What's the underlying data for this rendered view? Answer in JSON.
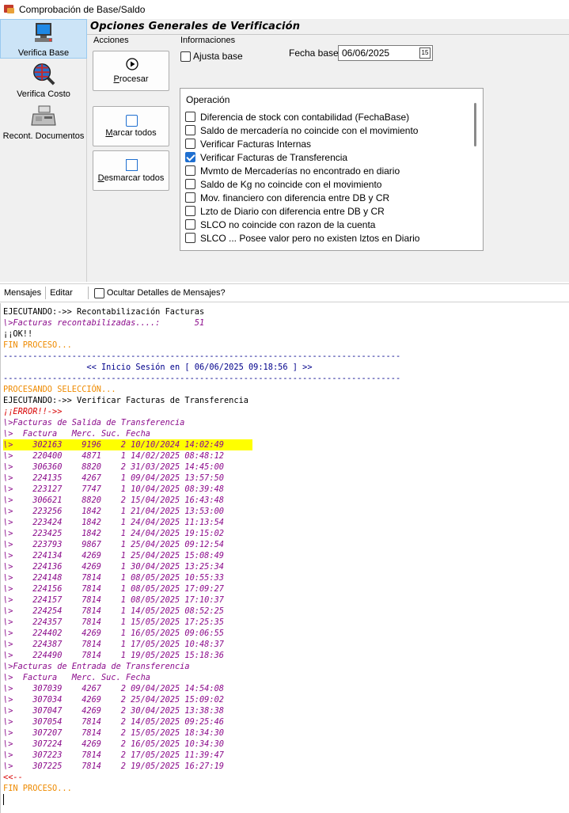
{
  "window": {
    "title": "Comprobación de Base/Saldo"
  },
  "nav": {
    "items": [
      {
        "label": "Verifica Base",
        "icon": "computer-icon",
        "active": true
      },
      {
        "label": "Verifica Costo",
        "icon": "globe-magnifier-icon",
        "active": false
      },
      {
        "label": "Recont. Documentos",
        "icon": "cash-register-icon",
        "active": false
      }
    ]
  },
  "header": {
    "title": "Opciones Generales de Verificación"
  },
  "acciones": {
    "label": "Acciones",
    "procesar_prefix": "",
    "procesar_underline": "P",
    "procesar_rest": "rocesar",
    "marcar_underline": "M",
    "marcar_rest": "arcar todos",
    "desmarcar_underline": "D",
    "desmarcar_rest": "esmarcar todos"
  },
  "informaciones": {
    "label": "Informaciones",
    "ajusta_base_label": "Ajusta base",
    "ajusta_base_checked": false,
    "fecha_base_label": "Fecha base",
    "fecha_base_value": "06/06/2025",
    "calendar_glyph": "15"
  },
  "operacion": {
    "title": "Operación",
    "items": [
      {
        "label": "Diferencia de stock con contabilidad (FechaBase)",
        "checked": false
      },
      {
        "label": "Saldo de mercadería no coincide con el movimiento",
        "checked": false
      },
      {
        "label": "Verificar Facturas Internas",
        "checked": false
      },
      {
        "label": "Verificar Facturas de Transferencia",
        "checked": true
      },
      {
        "label": "Mvmto de Mercaderías no encontrado en diario",
        "checked": false
      },
      {
        "label": "Saldo de Kg no coincide con el movimiento",
        "checked": false
      },
      {
        "label": "Mov. financiero con diferencia entre DB y CR",
        "checked": false
      },
      {
        "label": "Lzto de Diario con diferencia entre DB y CR",
        "checked": false
      },
      {
        "label": "SLCO no coincide con razon de la cuenta",
        "checked": false
      },
      {
        "label": "SLCO ... Posee valor pero no existen lztos en Diario",
        "checked": false
      }
    ]
  },
  "toolbar": {
    "mensajes": "Mensajes",
    "editar": "Editar",
    "ocultar_label": "Ocultar Detalles de Mensajes?",
    "ocultar_checked": false
  },
  "console": {
    "lines": [
      {
        "text": "EJECUTANDO:->> Recontabilización Facturas",
        "style": "black"
      },
      {
        "text": "\\>Facturas recontabilizadas....:       51",
        "style": "purple"
      },
      {
        "text": "¡¡OK!!",
        "style": "black"
      },
      {
        "text": "FIN PROCESO...",
        "style": "orange"
      },
      {
        "text": "---------------------------------------------------------------------------------",
        "style": "navy"
      },
      {
        "text": "                 << Inicio Sesión en [ 06/06/2025 09:18:56 ] >>",
        "style": "navy"
      },
      {
        "text": "---------------------------------------------------------------------------------",
        "style": "navy"
      },
      {
        "text": "PROCESANDO SELECCIÓN...",
        "style": "orange"
      },
      {
        "text": "EJECUTANDO:->> Verificar Facturas de Transferencia",
        "style": "black"
      },
      {
        "text": "¡¡ERROR!!->>",
        "style": "red"
      },
      {
        "text": "\\>Facturas de Salida de Transferencia",
        "style": "purple"
      },
      {
        "text": "\\>  Factura   Merc. Suc. Fecha",
        "style": "purple"
      },
      {
        "text": "\\>    302163    9196    2 10/10/2024 14:02:49",
        "style": "purple",
        "highlight": true
      },
      {
        "text": "\\>    220400    4871    1 14/02/2025 08:48:12",
        "style": "purple"
      },
      {
        "text": "\\>    306360    8820    2 31/03/2025 14:45:00",
        "style": "purple"
      },
      {
        "text": "\\>    224135    4267    1 09/04/2025 13:57:50",
        "style": "purple"
      },
      {
        "text": "\\>    223127    7747    1 10/04/2025 08:39:48",
        "style": "purple"
      },
      {
        "text": "\\>    306621    8820    2 15/04/2025 16:43:48",
        "style": "purple"
      },
      {
        "text": "\\>    223256    1842    1 21/04/2025 13:53:00",
        "style": "purple"
      },
      {
        "text": "\\>    223424    1842    1 24/04/2025 11:13:54",
        "style": "purple"
      },
      {
        "text": "\\>    223425    1842    1 24/04/2025 19:15:02",
        "style": "purple"
      },
      {
        "text": "\\>    223793    9867    1 25/04/2025 09:12:54",
        "style": "purple"
      },
      {
        "text": "\\>    224134    4269    1 25/04/2025 15:08:49",
        "style": "purple"
      },
      {
        "text": "\\>    224136    4269    1 30/04/2025 13:25:34",
        "style": "purple"
      },
      {
        "text": "\\>    224148    7814    1 08/05/2025 10:55:33",
        "style": "purple"
      },
      {
        "text": "\\>    224156    7814    1 08/05/2025 17:09:27",
        "style": "purple"
      },
      {
        "text": "\\>    224157    7814    1 08/05/2025 17:10:37",
        "style": "purple"
      },
      {
        "text": "\\>    224254    7814    1 14/05/2025 08:52:25",
        "style": "purple"
      },
      {
        "text": "\\>    224357    7814    1 15/05/2025 17:25:35",
        "style": "purple"
      },
      {
        "text": "\\>    224402    4269    1 16/05/2025 09:06:55",
        "style": "purple"
      },
      {
        "text": "\\>    224387    7814    1 17/05/2025 10:48:37",
        "style": "purple"
      },
      {
        "text": "\\>    224490    7814    1 19/05/2025 15:18:36",
        "style": "purple"
      },
      {
        "text": "\\>Facturas de Entrada de Transferencia",
        "style": "purple"
      },
      {
        "text": "\\>  Factura   Merc. Suc. Fecha",
        "style": "purple"
      },
      {
        "text": "\\>    307039    4267    2 09/04/2025 14:54:08",
        "style": "purple"
      },
      {
        "text": "\\>    307034    4269    2 25/04/2025 15:09:02",
        "style": "purple"
      },
      {
        "text": "\\>    307047    4269    2 30/04/2025 13:38:38",
        "style": "purple"
      },
      {
        "text": "\\>    307054    7814    2 14/05/2025 09:25:46",
        "style": "purple"
      },
      {
        "text": "\\>    307207    7814    2 15/05/2025 18:34:30",
        "style": "purple"
      },
      {
        "text": "\\>    307224    4269    2 16/05/2025 10:34:30",
        "style": "purple"
      },
      {
        "text": "\\>    307223    7814    2 17/05/2025 11:39:47",
        "style": "purple"
      },
      {
        "text": "\\>    307225    7814    2 19/05/2025 16:27:19",
        "style": "purple"
      },
      {
        "text": "<<--",
        "style": "red"
      },
      {
        "text": "FIN PROCESO...",
        "style": "orange"
      }
    ]
  },
  "colors": {
    "purple": "#8b0b8b",
    "orange": "#ee8a00",
    "red": "#d80000",
    "navy": "#00008b",
    "highlight": "#ffff00",
    "accent": "#1f6fd0"
  }
}
